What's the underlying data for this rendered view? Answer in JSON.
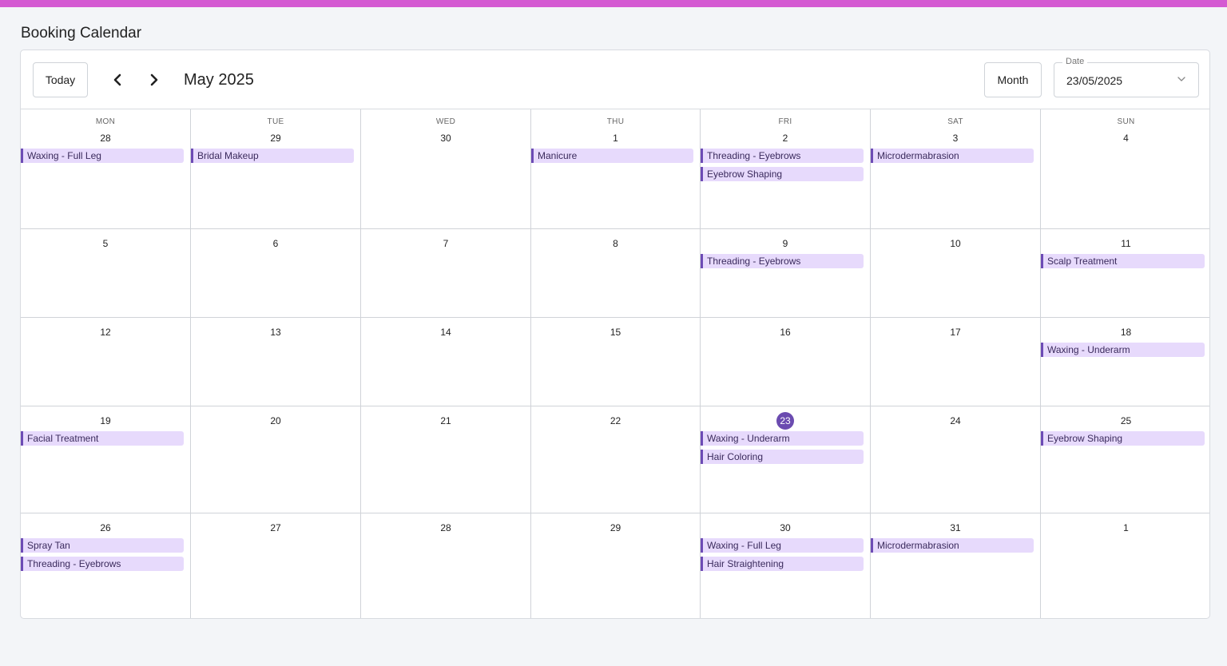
{
  "page": {
    "title": "Booking Calendar"
  },
  "toolbar": {
    "today_label": "Today",
    "prev_icon": "chevron-left-icon",
    "next_icon": "chevron-right-icon",
    "month_label": "May 2025",
    "view_label": "Month",
    "date_legend": "Date",
    "date_value": "23/05/2025"
  },
  "colors": {
    "top_bar": "#d45ad2",
    "event_bg": "#e7dafc",
    "event_accent": "#6d4bb5",
    "today_circle": "#6b4bb0"
  },
  "calendar": {
    "weekdays": [
      "MON",
      "TUE",
      "WED",
      "THU",
      "FRI",
      "SAT",
      "SUN"
    ],
    "weeks": [
      {
        "days": [
          {
            "num": "28",
            "events": [
              "Waxing - Full Leg"
            ]
          },
          {
            "num": "29",
            "events": [
              "Bridal Makeup"
            ]
          },
          {
            "num": "30",
            "events": []
          },
          {
            "num": "1",
            "events": [
              "Manicure"
            ]
          },
          {
            "num": "2",
            "events": [
              "Threading - Eyebrows",
              "Eyebrow Shaping"
            ]
          },
          {
            "num": "3",
            "events": [
              "Microdermabrasion"
            ]
          },
          {
            "num": "4",
            "events": []
          }
        ]
      },
      {
        "days": [
          {
            "num": "5",
            "events": []
          },
          {
            "num": "6",
            "events": []
          },
          {
            "num": "7",
            "events": []
          },
          {
            "num": "8",
            "events": []
          },
          {
            "num": "9",
            "events": [
              "Threading - Eyebrows"
            ]
          },
          {
            "num": "10",
            "events": []
          },
          {
            "num": "11",
            "events": [
              "Scalp Treatment"
            ]
          }
        ]
      },
      {
        "days": [
          {
            "num": "12",
            "events": []
          },
          {
            "num": "13",
            "events": []
          },
          {
            "num": "14",
            "events": []
          },
          {
            "num": "15",
            "events": []
          },
          {
            "num": "16",
            "events": []
          },
          {
            "num": "17",
            "events": []
          },
          {
            "num": "18",
            "events": [
              "Waxing - Underarm"
            ]
          }
        ]
      },
      {
        "days": [
          {
            "num": "19",
            "events": [
              "Facial Treatment"
            ]
          },
          {
            "num": "20",
            "events": []
          },
          {
            "num": "21",
            "events": []
          },
          {
            "num": "22",
            "events": []
          },
          {
            "num": "23",
            "today": true,
            "events": [
              "Waxing - Underarm",
              "Hair Coloring"
            ]
          },
          {
            "num": "24",
            "events": []
          },
          {
            "num": "25",
            "events": [
              "Eyebrow Shaping"
            ]
          }
        ]
      },
      {
        "days": [
          {
            "num": "26",
            "events": [
              "Spray Tan",
              "Threading - Eyebrows"
            ]
          },
          {
            "num": "27",
            "events": []
          },
          {
            "num": "28",
            "events": []
          },
          {
            "num": "29",
            "events": []
          },
          {
            "num": "30",
            "events": [
              "Waxing - Full Leg",
              "Hair Straightening"
            ]
          },
          {
            "num": "31",
            "events": [
              "Microdermabrasion"
            ]
          },
          {
            "num": "1",
            "events": []
          }
        ]
      }
    ]
  }
}
